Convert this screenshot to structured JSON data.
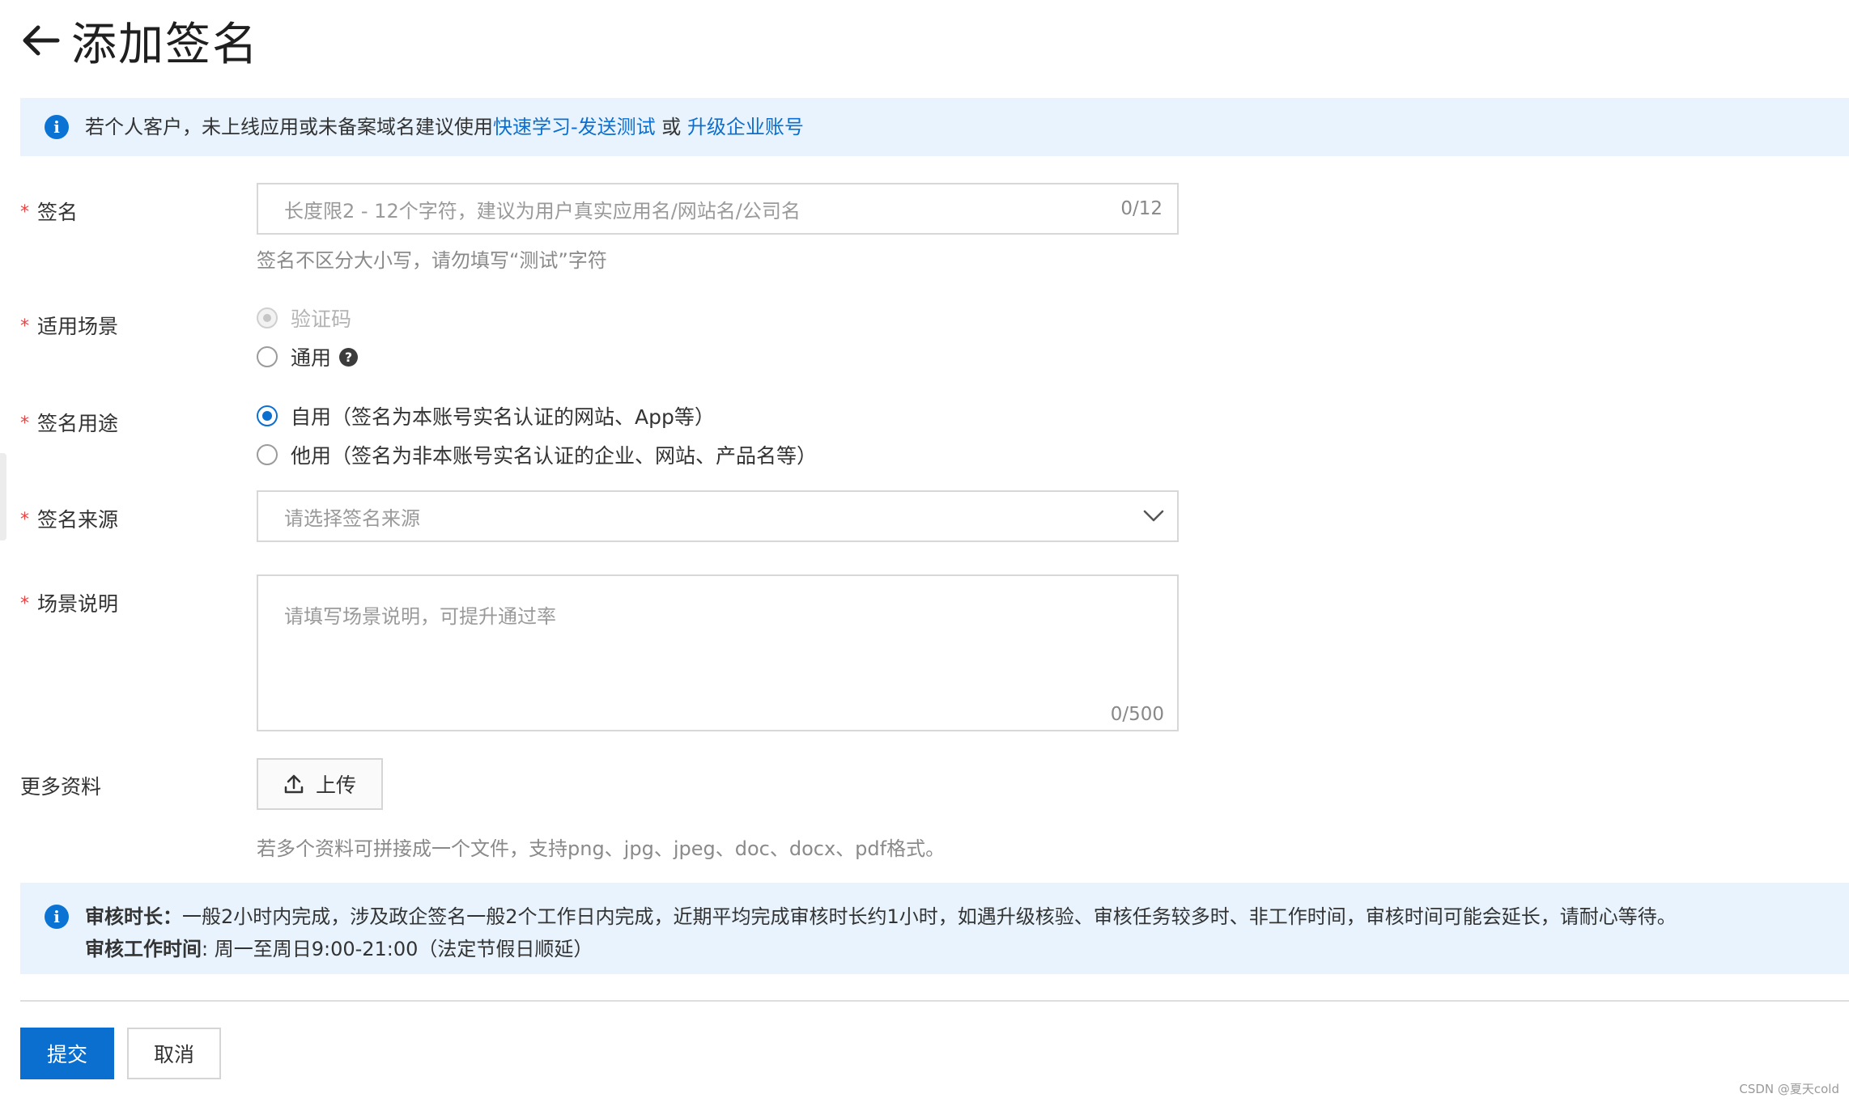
{
  "header": {
    "title": "添加签名"
  },
  "top_notice": {
    "text": "若个人客户，未上线应用或未备案域名建议使用",
    "link1": "快速学习-发送测试",
    "connector": " 或 ",
    "link2": "升级企业账号"
  },
  "form": {
    "required_mark": "*",
    "signature": {
      "label": "签名",
      "placeholder": "长度限2 - 12个字符，建议为用户真实应用名/网站名/公司名",
      "counter": "0/12",
      "helper": "签名不区分大小写，请勿填写“测试”字符"
    },
    "scenario": {
      "label": "适用场景",
      "options": [
        {
          "label": "验证码",
          "state": "disabled"
        },
        {
          "label": "通用",
          "state": "unchecked",
          "help_icon": "question-circle-icon"
        }
      ]
    },
    "purpose": {
      "label": "签名用途",
      "options": [
        {
          "label": "自用（签名为本账号实名认证的网站、App等）",
          "state": "checked"
        },
        {
          "label": "他用（签名为非本账号实名认证的企业、网站、产品名等）",
          "state": "unchecked"
        }
      ]
    },
    "source": {
      "label": "签名来源",
      "placeholder": "请选择签名来源"
    },
    "description": {
      "label": "场景说明",
      "placeholder": "请填写场景说明，可提升通过率",
      "counter": "0/500"
    },
    "attachments": {
      "label": "更多资料",
      "upload_label": "上传",
      "helper": "若多个资料可拼接成一个文件，支持png、jpg、jpeg、doc、docx、pdf格式。"
    }
  },
  "review_notice": {
    "duration_title": "审核时长：",
    "duration_text": "一般2小时内完成，涉及政企签名一般2个工作日内完成，近期平均完成审核时长约1小时，如遇升级核验、审核任务较多时、非工作时间，审核时间可能会延长，请耐心等待。",
    "hours_title": "审核工作时间",
    "hours_text": ": 周一至周日9:00-21:00（法定节假日顺延）"
  },
  "actions": {
    "submit": "提交",
    "cancel": "取消"
  },
  "watermark": "CSDN @夏天cold",
  "colors": {
    "primary": "#0b6fd0",
    "banner_bg": "#e8f3fd",
    "required": "#e54545"
  }
}
